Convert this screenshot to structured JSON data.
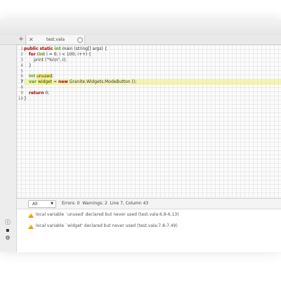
{
  "tabs": [
    {
      "label": "test.vala"
    }
  ],
  "editor": {
    "line_numbers": [
      "1",
      "2",
      "3",
      "4",
      "5",
      "6",
      "7",
      "8",
      "9",
      "10"
    ],
    "current_line": 7
  },
  "code": {
    "l1_kw1": "public",
    "l1_kw2": "static",
    "l1_ty": "int",
    "l1_rest": " main (string[] args) {",
    "l2_kw": "for",
    "l2_a": " (",
    "l2_ty": "int",
    "l2_rest": " i = 0; i < 100; i++) {",
    "l3": "print (\"%i\\n\", i);",
    "l4": "}",
    "l6_ty": "int",
    "l6_word": "unused",
    "l6_end": ";",
    "l7_ty": "var",
    "l7_word": "widget",
    "l7_mid": " = ",
    "l7_kw": "new",
    "l7_rest": " Granite.Widgets.ModeButton ();",
    "l9_kw": "return",
    "l9_rest": " 0;",
    "l10": "}"
  },
  "bottom_panel": {
    "filter_selected": "All",
    "status": "Errors: 0  Warnings: 2  Line 7, Column 43",
    "messages": [
      {
        "text": "local variable `unused' declared but never used (test.vala:6.8-6.13)"
      },
      {
        "text": "local variable `widget' declared but never used (test.vala:7.8-7.49)"
      }
    ]
  },
  "colors": {
    "warning": "#e8a200",
    "keyword": "#a40000",
    "type": "#4e9a06",
    "highlight": "#f0f070"
  },
  "icons": {
    "new_tab": "plus-icon",
    "close_tab": "close-icon",
    "info": "info-icon",
    "terminal": "terminal-icon",
    "settings": "gear-icon",
    "warning": "warning-icon"
  }
}
